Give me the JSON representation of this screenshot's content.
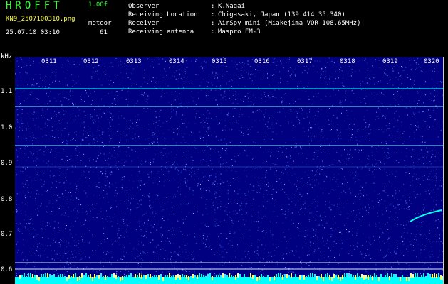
{
  "header": {
    "app_title": "HROFFT",
    "version": "1.00f",
    "filename": "KN9_2507100310.png",
    "meteor_label": "meteor",
    "timestamp": "25.07.10 03:10",
    "meteor_count": "61"
  },
  "meta": [
    {
      "key": "Observer",
      "value": "K.Nagai"
    },
    {
      "key": "Receiving Location",
      "value": "Chigasaki, Japan (139.414 35.340)"
    },
    {
      "key": "Receiver",
      "value": "AirSpy mini (Miakejima VOR 108.65MHz)"
    },
    {
      "key": "Receiving antenna",
      "value": "Maspro FM-3"
    }
  ],
  "separator": ":",
  "spectrogram": {
    "y_unit": "kHz",
    "y_ticks": [
      "1.1",
      "1.0",
      "0.9",
      "0.8",
      "0.7",
      "0.6"
    ],
    "x_ticks": [
      "0311",
      "0312",
      "0313",
      "0314",
      "0315",
      "0316",
      "0317",
      "0318",
      "0319",
      "0320"
    ],
    "tone_lines_khz": [
      1.11,
      1.06,
      0.95,
      0.89
    ],
    "colors": {
      "background": "#000080",
      "noise": "#3a6cff",
      "tone": "#00ffff",
      "bottom_band": "#00ffff"
    }
  }
}
